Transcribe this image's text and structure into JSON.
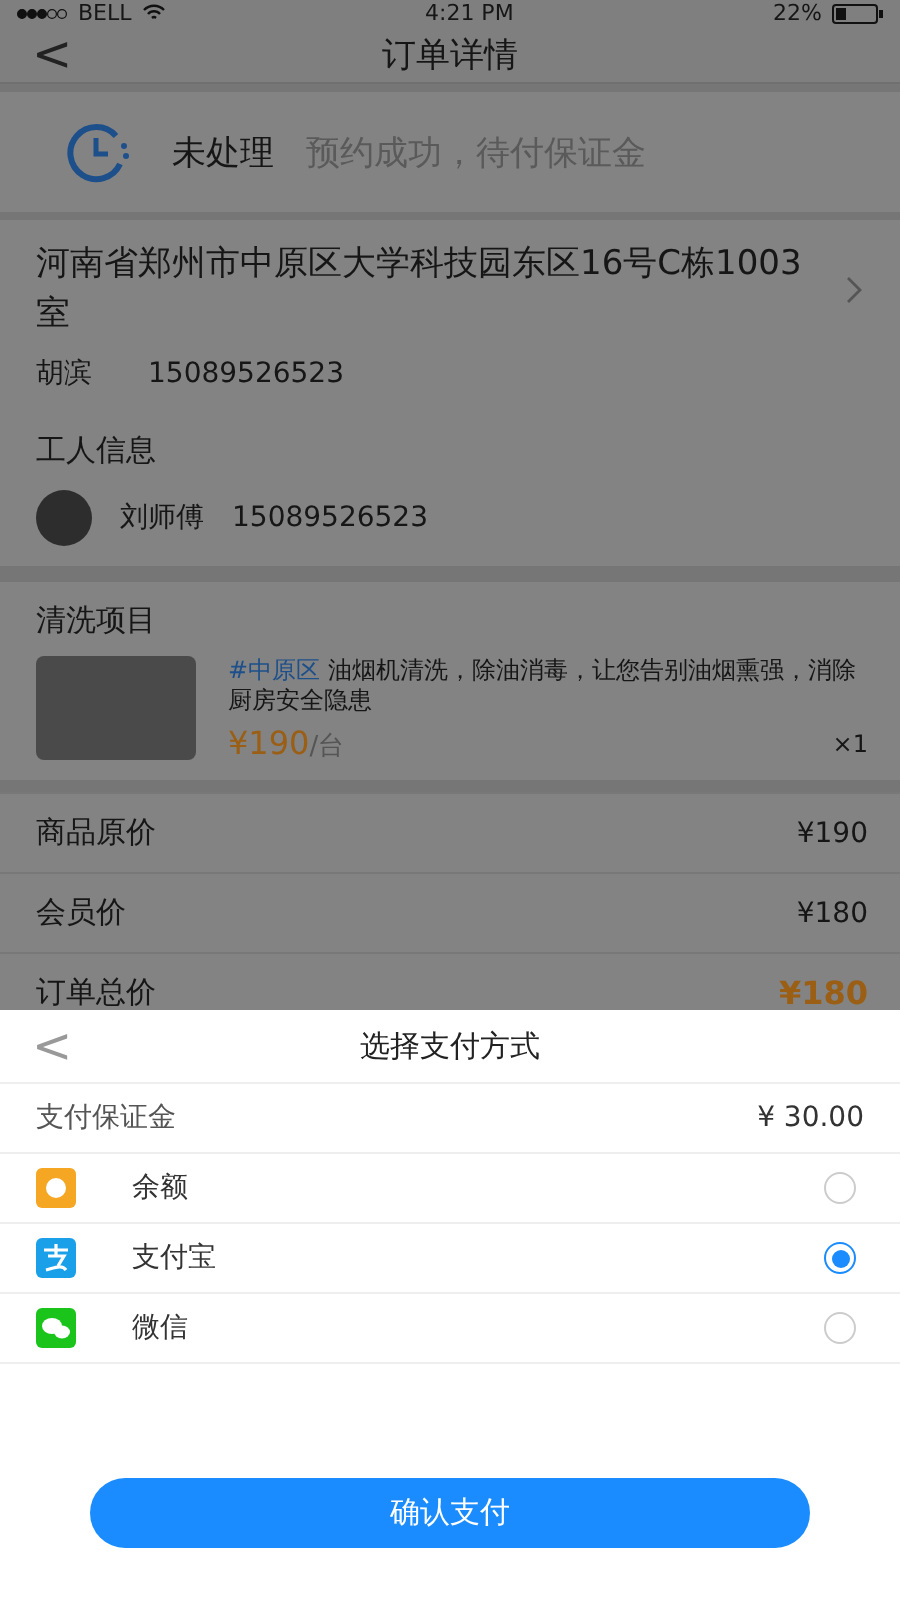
{
  "status_bar": {
    "carrier": "BELL",
    "time": "4:21 PM",
    "battery": "22%"
  },
  "nav": {
    "back": "<",
    "title": "订单详情"
  },
  "order_status": {
    "state": "未处理",
    "message": "预约成功，待付保证金"
  },
  "address": {
    "line": "河南省郑州市中原区大学科技园东区16号C栋1003室",
    "name": "胡滨",
    "phone": "15089526523"
  },
  "worker": {
    "heading": "工人信息",
    "name": "刘师傅",
    "phone": "15089526523"
  },
  "service": {
    "heading": "清洗项目",
    "tag": "#中原区",
    "description": "油烟机清洗，除油消毒，让您告别油烟熏强，消除厨房安全隐患",
    "price": "¥190",
    "unit": "/台",
    "quantity": "×1"
  },
  "prices": [
    {
      "label": "商品原价",
      "value": "¥190",
      "highlight": false
    },
    {
      "label": "会员价",
      "value": "¥180",
      "highlight": false
    },
    {
      "label": "订单总价",
      "value": "¥180",
      "highlight": true
    }
  ],
  "payment_sheet": {
    "back": "<",
    "title": "选择支付方式",
    "deposit_label": "支付保证金",
    "deposit_value": "¥ 30.00",
    "methods": [
      {
        "kind": "balance",
        "label": "余额",
        "selected": false
      },
      {
        "kind": "alipay",
        "label": "支付宝",
        "selected": true
      },
      {
        "kind": "wechat",
        "label": "微信",
        "selected": false
      }
    ],
    "confirm": "确认支付"
  }
}
